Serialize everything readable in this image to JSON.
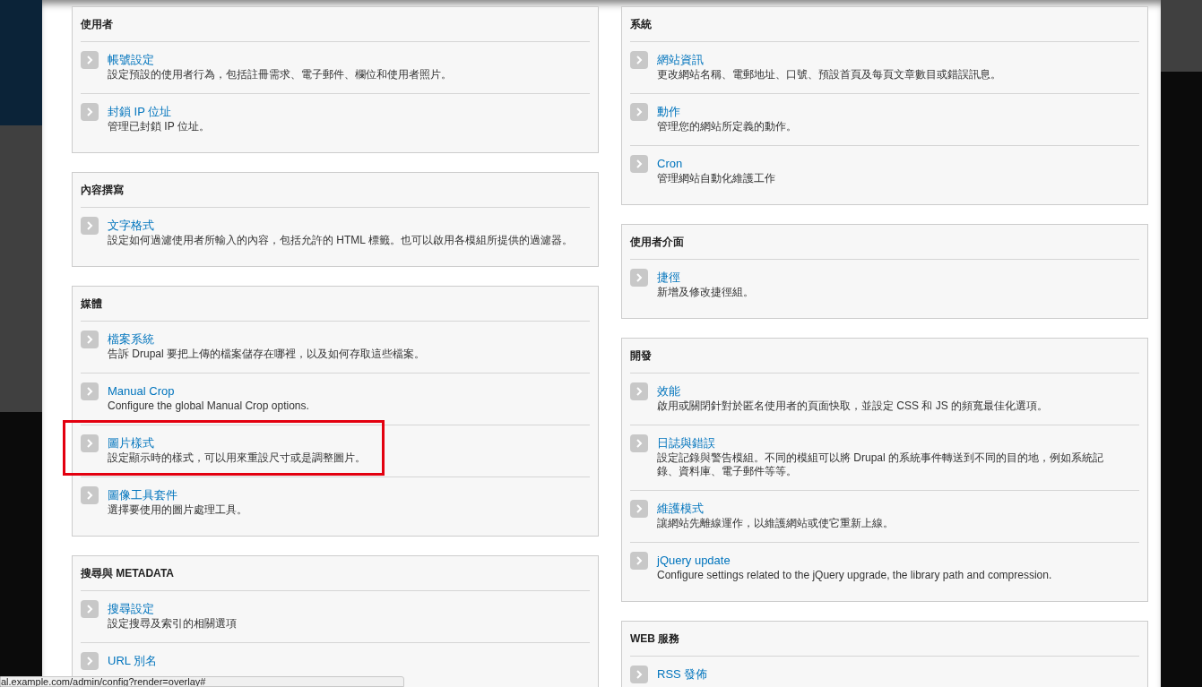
{
  "columns": [
    {
      "panels": [
        {
          "heading": "使用者",
          "items": [
            {
              "title": "帳號設定",
              "description": "設定預設的使用者行為，包括註冊需求、電子郵件、欄位和使用者照片。",
              "highlighted": false
            },
            {
              "title": "封鎖 IP 位址",
              "description": "管理已封鎖 IP 位址。",
              "highlighted": false
            }
          ]
        },
        {
          "heading": "內容撰寫",
          "items": [
            {
              "title": "文字格式",
              "description": "設定如何過濾使用者所輸入的內容，包括允許的 HTML 標籤。也可以啟用各模組所提供的過濾器。",
              "highlighted": false
            }
          ]
        },
        {
          "heading": "媒體",
          "items": [
            {
              "title": "檔案系統",
              "description": "告訴 Drupal 要把上傳的檔案儲存在哪裡，以及如何存取這些檔案。",
              "highlighted": false
            },
            {
              "title": "Manual Crop",
              "description": "Configure the global Manual Crop options.",
              "highlighted": false
            },
            {
              "title": "圖片樣式",
              "description": "設定顯示時的樣式，可以用來重設尺寸或是調整圖片。",
              "highlighted": true
            },
            {
              "title": "圖像工具套件",
              "description": "選擇要使用的圖片處理工具。",
              "highlighted": false
            }
          ]
        },
        {
          "heading": "搜尋與 METADATA",
          "items": [
            {
              "title": "搜尋設定",
              "description": "設定搜尋及索引的相關選項",
              "highlighted": false
            },
            {
              "title": "URL 別名",
              "highlighted": false
            }
          ]
        }
      ]
    },
    {
      "panels": [
        {
          "heading": "系統",
          "items": [
            {
              "title": "網站資訊",
              "description": "更改網站名稱、電郵地址、口號、預設首頁及每頁文章數目或錯誤訊息。",
              "highlighted": false
            },
            {
              "title": "動作",
              "description": "管理您的網站所定義的動作。",
              "highlighted": false
            },
            {
              "title": "Cron",
              "description": "管理網站自動化維護工作",
              "highlighted": false
            }
          ]
        },
        {
          "heading": "使用者介面",
          "items": [
            {
              "title": "捷徑",
              "description": "新增及修改捷徑組。",
              "highlighted": false
            }
          ]
        },
        {
          "heading": "開發",
          "items": [
            {
              "title": "效能",
              "description": "啟用或關閉針對於匿名使用者的頁面快取，並設定 CSS 和 JS 的頻寬最佳化選項。",
              "highlighted": false
            },
            {
              "title": "日誌與錯誤",
              "description": "設定記錄與警告模組。不同的模組可以將 Drupal 的系統事件轉送到不同的目的地，例如系統記錄、資料庫、電子郵件等等。",
              "highlighted": false
            },
            {
              "title": "維護模式",
              "description": "讓網站先離線運作，以維護網站或使它重新上線。",
              "highlighted": false
            },
            {
              "title": "jQuery update",
              "description": "Configure settings related to the jQuery upgrade, the library path and compression.",
              "highlighted": false
            }
          ]
        },
        {
          "heading": "WEB 服務",
          "items": [
            {
              "title": "RSS 發佈",
              "highlighted": false
            }
          ]
        }
      ]
    }
  ],
  "status_bar": "al.example.com/admin/config?render=overlay#"
}
